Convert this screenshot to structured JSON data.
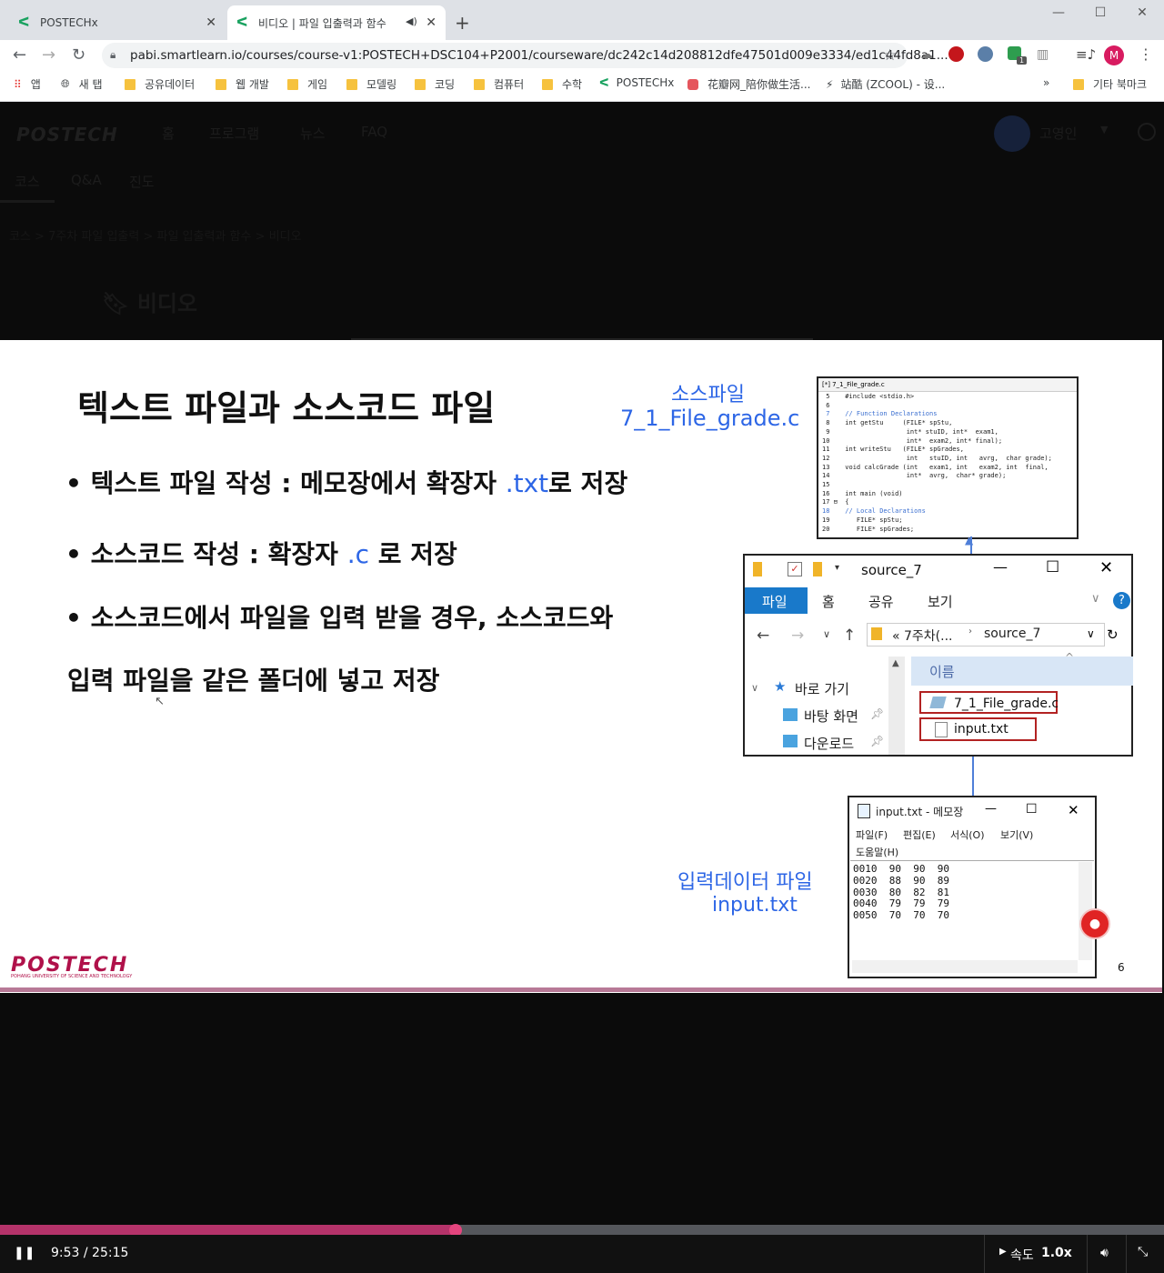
{
  "browser": {
    "tabs": [
      {
        "title": "POSTECHx"
      },
      {
        "title": "비디오 | 파일 입출력과 함수"
      }
    ],
    "url": "pabi.smartlearn.io/courses/course-v1:POSTECH+DSC104+P2001/courseware/dc242c14d208812dfe47501d009e3334/ed1c44fd8a1...",
    "bookmarks": [
      "앱",
      "새 탭",
      "공유데이터",
      "웹 개발",
      "게임",
      "모델링",
      "코딩",
      "컴퓨터",
      "수학",
      "POSTECHx",
      "花瓣网_陪你做生活...",
      "站酷 (ZCOOL) - 设...",
      "기타 북마크"
    ],
    "profile_initial": "M",
    "extension_badge": "1"
  },
  "site": {
    "logo": "POSTECH",
    "nav": [
      "홈",
      "프로그램",
      "뉴스",
      "FAQ"
    ],
    "user": "고영인",
    "tabs": [
      "코스",
      "Q&A",
      "진도"
    ],
    "breadcrumb": "코스 > 7주차 파일 입출력 > 파일 입출력과 함수 > 비디오",
    "heading": "비디오"
  },
  "slide": {
    "title": "텍스트 파일과 소스코드 파일",
    "bullet1_prefix": "• 텍스트 파일 작성 : 메모장에서 확장자 ",
    "bullet1_ext": ".txt",
    "bullet1_suffix": "로 저장",
    "bullet2_prefix": "• 소스코드 작성 : 확장자 ",
    "bullet2_ext": ".c",
    "bullet2_suffix": " 로 저장",
    "bullet3_line1": "• 소스코드에서 파일을 입력 받을 경우, 소스코드와",
    "bullet3_line2": "입력 파일을 같은 폴더에 넣고 저장",
    "source_label_1": "소스파일",
    "source_label_2": "7_1_File_grade.c",
    "input_label_1": "입력데이터 파일",
    "input_label_2": "input.txt",
    "page_number": "6",
    "footer_logo": "POSTECH",
    "footer_sub": "POHANG UNIVERSITY OF SCIENCE AND TECHNOLOGY",
    "code_title": "[*] 7_1_File_grade.c",
    "code_lines": [
      " 5    #include <stdio.h>",
      " 6",
      " 7    // Function Declarations",
      " 8    int getStu     (FILE* spStu,",
      " 9                    int* stuID, int*  exam1,",
      "10                    int*  exam2, int* final);",
      "11    int writeStu   (FILE* spGrades,",
      "12                    int   stuID, int   avrg,  char grade);",
      "13    void calcGrade (int   exam1, int   exam2, int  final,",
      "14                    int*  avrg,  char* grade);",
      "15",
      "16    int main (void)",
      "17 ⊟  {",
      "18    // Local Declarations",
      "19       FILE* spStu;",
      "20       FILE* spGrades;"
    ],
    "explorer": {
      "title": "source_7",
      "ribbon": [
        "파일",
        "홈",
        "공유",
        "보기"
      ],
      "path_1": "« 7주차(...",
      "path_2": "source_7",
      "column": "이름",
      "nav": [
        "바로 가기",
        "바탕 화면",
        "다운로드"
      ],
      "files": [
        "7_1_File_grade.c",
        "input.txt"
      ]
    },
    "notepad": {
      "title": "input.txt - 메모장",
      "menu": [
        "파일(F)",
        "편집(E)",
        "서식(O)",
        "보기(V)",
        "도움말(H)"
      ],
      "lines": [
        "0010  90  90  90",
        "0020  88  90  89",
        "0030  80  82  81",
        "0040  79  79  79",
        "0050  70  70  70"
      ]
    }
  },
  "player": {
    "time": "9:53 / 25:15",
    "progress": 0.3917,
    "speed_label": "속도",
    "speed_value": "1.0x"
  }
}
